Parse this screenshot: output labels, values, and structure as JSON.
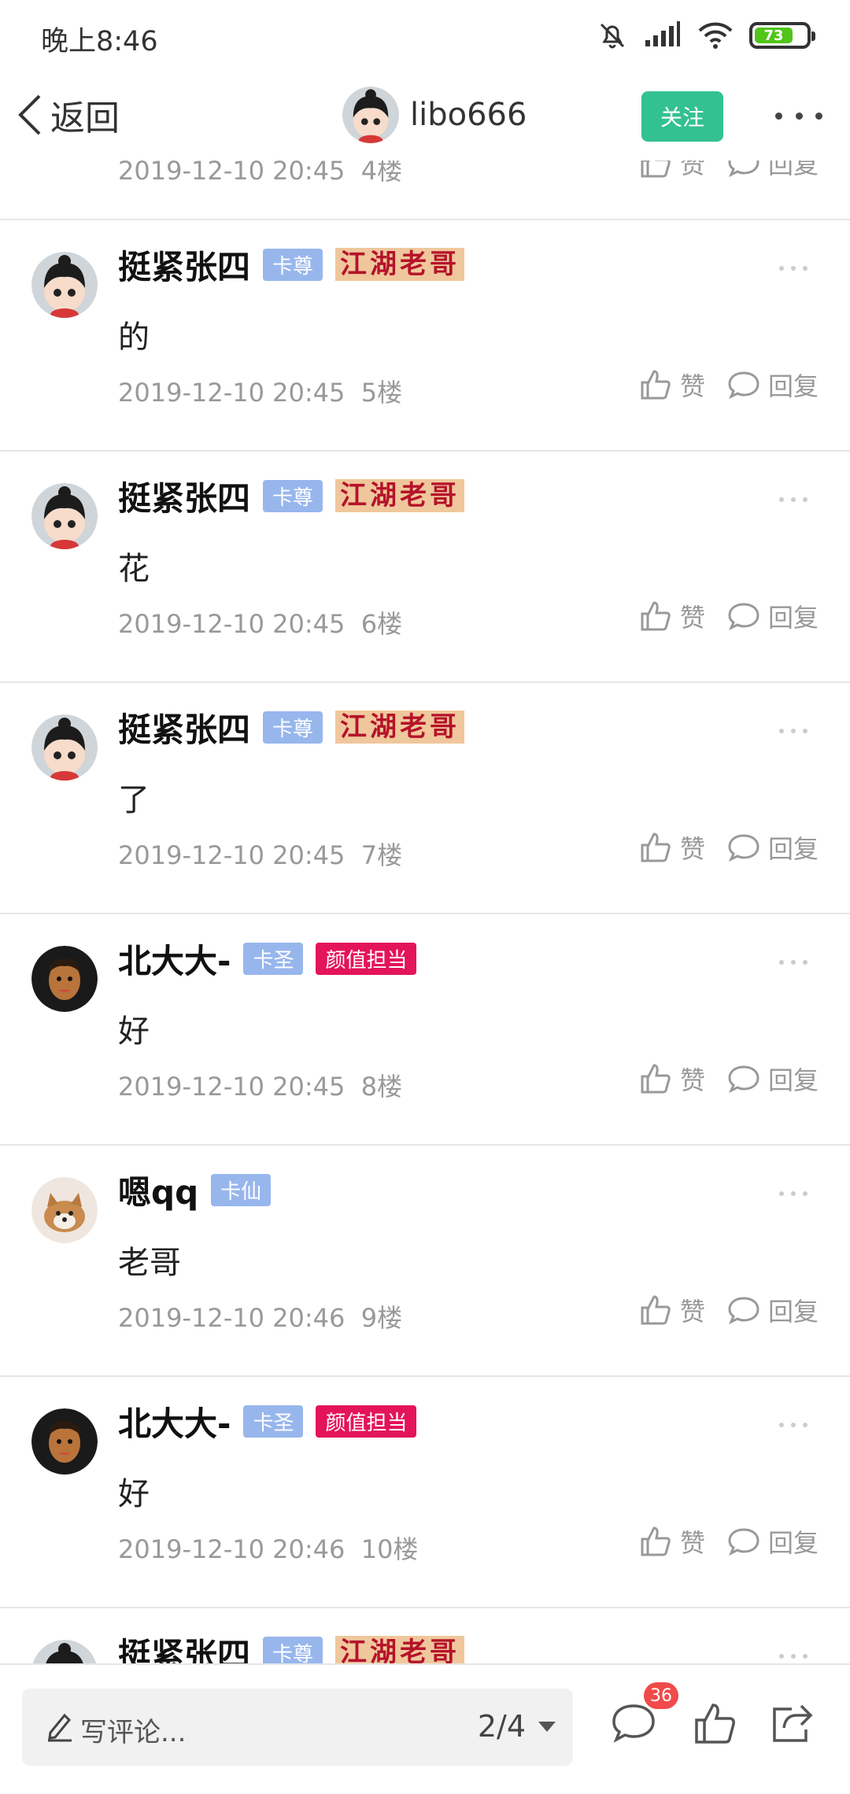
{
  "status_bar": {
    "time": "晚上8:46",
    "battery": "73"
  },
  "nav": {
    "back_label": "返回",
    "username": "libo666",
    "follow_label": "关注"
  },
  "partial_top": {
    "timestamp": "2019-12-10 20:45",
    "floor": "4楼",
    "like_label": "赞",
    "reply_label": "回复"
  },
  "comments": [
    {
      "user": "挺紧张四",
      "badge": "卡尊",
      "title_badge": "江湖老哥",
      "title_type": "jianghu",
      "text": "的",
      "timestamp": "2019-12-10 20:45",
      "floor": "5楼",
      "like_label": "赞",
      "reply_label": "回复",
      "avatar": "cartoon-girl"
    },
    {
      "user": "挺紧张四",
      "badge": "卡尊",
      "title_badge": "江湖老哥",
      "title_type": "jianghu",
      "text": "花",
      "timestamp": "2019-12-10 20:45",
      "floor": "6楼",
      "like_label": "赞",
      "reply_label": "回复",
      "avatar": "cartoon-girl"
    },
    {
      "user": "挺紧张四",
      "badge": "卡尊",
      "title_badge": "江湖老哥",
      "title_type": "jianghu",
      "text": "了",
      "timestamp": "2019-12-10 20:45",
      "floor": "7楼",
      "like_label": "赞",
      "reply_label": "回复",
      "avatar": "cartoon-girl"
    },
    {
      "user": "北大大-",
      "badge": "卡圣",
      "title_badge": "颜值担当",
      "title_type": "red",
      "text": "好",
      "timestamp": "2019-12-10 20:45",
      "floor": "8楼",
      "like_label": "赞",
      "reply_label": "回复",
      "avatar": "dark-man"
    },
    {
      "user": "嗯qq",
      "badge": "卡仙",
      "title_badge": "",
      "title_type": "none",
      "text": "老哥",
      "timestamp": "2019-12-10 20:46",
      "floor": "9楼",
      "like_label": "赞",
      "reply_label": "回复",
      "avatar": "dog"
    },
    {
      "user": "北大大-",
      "badge": "卡圣",
      "title_badge": "颜值担当",
      "title_type": "red",
      "text": "好",
      "timestamp": "2019-12-10 20:46",
      "floor": "10楼",
      "like_label": "赞",
      "reply_label": "回复",
      "avatar": "dark-man"
    },
    {
      "user": "挺紧张四",
      "badge": "卡尊",
      "title_badge": "江湖老哥",
      "title_type": "jianghu",
      "text": "",
      "timestamp": "",
      "floor": "",
      "like_label": "",
      "reply_label": "",
      "avatar": "cartoon-girl"
    }
  ],
  "bottom_bar": {
    "placeholder": "写评论...",
    "page_indicator": "2/4",
    "comment_count": "36"
  },
  "colors": {
    "follow": "#33c191",
    "badge_blue": "#97b6ec",
    "badge_red": "#e3145a",
    "notify": "#f04a4a"
  }
}
